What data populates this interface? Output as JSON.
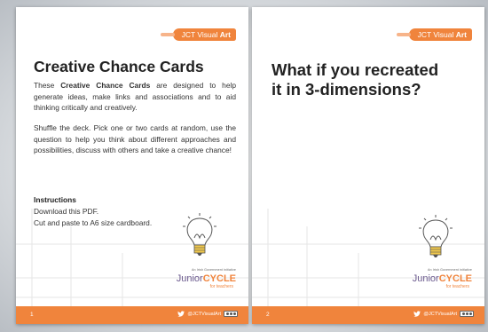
{
  "brand": {
    "prefix": "JCT Visual ",
    "bold": "Art"
  },
  "colors": {
    "accent": "#f0843c",
    "logo_purple": "#6b5a8e"
  },
  "pages": [
    {
      "title": "Creative Chance Cards",
      "intro": {
        "before": "These ",
        "bold": "Creative Chance Cards",
        "after": " are designed to help generate ideas, make links and associations and to aid thinking critically and creatively."
      },
      "shuffle": "Shuffle the deck. Pick one or two cards at random, use the question to help you think about different approaches and possibilities, discuss with others and take a creative chance!",
      "instructions": {
        "heading": "Instructions",
        "lines": [
          "Download this PDF.",
          "Cut and paste to A6 size cardboard."
        ]
      },
      "footer": {
        "page_number": "1"
      }
    },
    {
      "question": "What if you recreated it in 3-dimensions?",
      "footer": {
        "page_number": "2"
      }
    }
  ],
  "logo": {
    "small_text": "An Irish Government initiative",
    "junior": "Junior",
    "cycle": "CYCLE",
    "sub": "for teachers"
  },
  "footer": {
    "twitter_handle": "@JCTVisualArt"
  },
  "icons": {
    "twitter": "twitter-bird",
    "license": "creative-commons-badge",
    "bulb": "lightbulb-doodle"
  }
}
